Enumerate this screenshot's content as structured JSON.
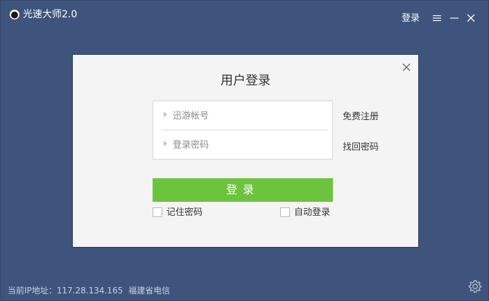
{
  "app": {
    "title": "光速大师2.0",
    "top_login_label": "登录",
    "icons": {
      "logo": "orb-logo-icon",
      "menu": "hamburger-menu-icon",
      "minimize": "minimize-icon",
      "close": "close-icon",
      "settings": "gear-icon"
    },
    "colors": {
      "background": "#3e547c",
      "dialog_background": "#f4f4f4",
      "login_button": "#6cc43e",
      "footer_text": "#c8d2e4"
    }
  },
  "dialog": {
    "title": "用户登录",
    "username": {
      "value": "",
      "placeholder": "迅游帐号"
    },
    "password": {
      "value": "",
      "placeholder": "登录密码"
    },
    "register_link": "免费注册",
    "recover_link": "找回密码",
    "login_button": "登录",
    "remember_password": {
      "label": "记住密码",
      "checked": false
    },
    "auto_login": {
      "label": "自动登录",
      "checked": false
    }
  },
  "footer": {
    "ip_label": "当前IP地址：",
    "ip_address": "117.28.134.165",
    "isp": "福建省电信"
  }
}
